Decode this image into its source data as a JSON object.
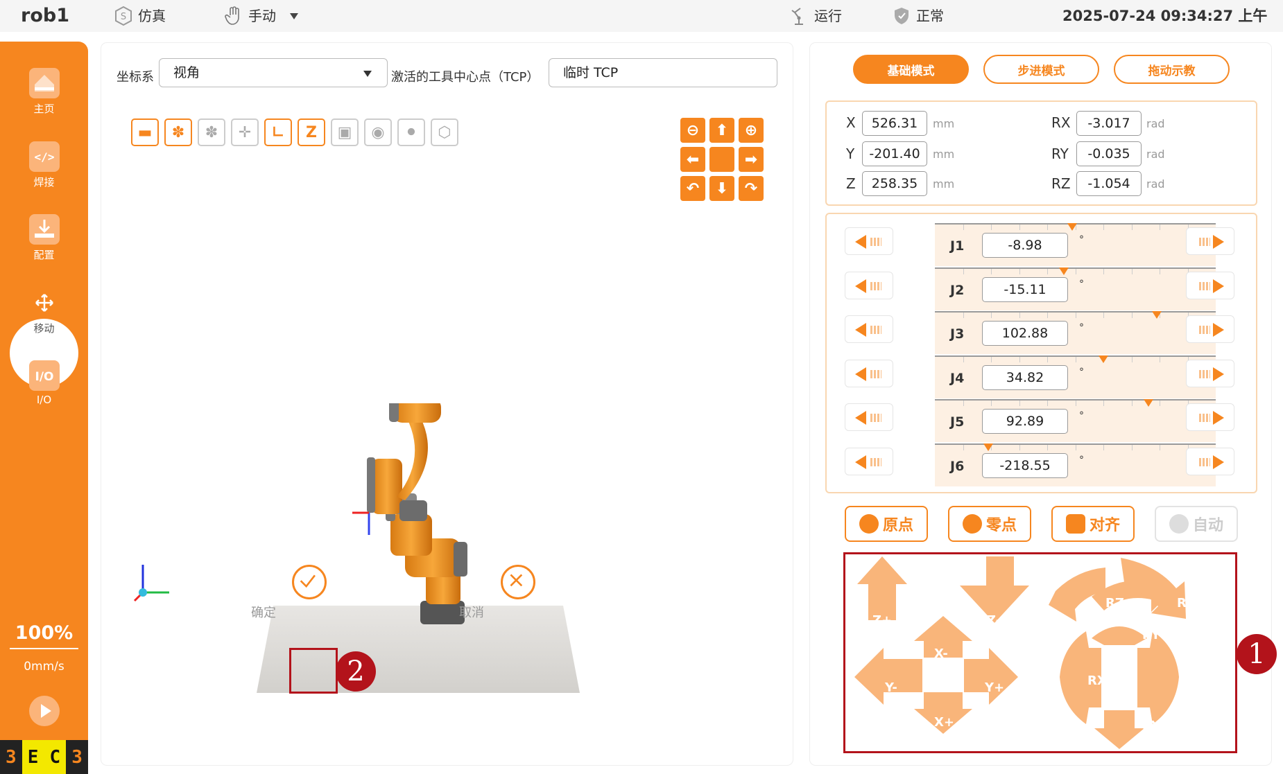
{
  "topbar": {
    "brand": "rob1",
    "sim_label": "仿真",
    "manual_label": "手动",
    "run_label": "运行",
    "status_label": "正常",
    "datetime": "2025-07-24 09:34:27 上午"
  },
  "sidebar": {
    "items": [
      {
        "label": "主页",
        "icon": "home-icon"
      },
      {
        "label": "焊接",
        "icon": "code-icon"
      },
      {
        "label": "配置",
        "icon": "download-icon"
      },
      {
        "label": "移动",
        "icon": "move-icon"
      },
      {
        "label": "I/O",
        "icon": "io-icon"
      }
    ],
    "speed_percent": "100%",
    "speed_value": "0mm/s",
    "badges": [
      "3",
      "E",
      "C",
      "3"
    ]
  },
  "view": {
    "coord_label": "坐标系",
    "coord_value": "视角",
    "tcp_label": "激活的工具中心点（TCP）",
    "tcp_value": "临时 TCP",
    "confirm_label": "确定",
    "cancel_label": "取消",
    "callout_confirm": "2"
  },
  "modes": [
    "基础模式",
    "步进模式",
    "拖动示教"
  ],
  "cartesian": {
    "x": {
      "label": "X",
      "value": "526.31",
      "unit": "mm"
    },
    "y": {
      "label": "Y",
      "value": "-201.40",
      "unit": "mm"
    },
    "z": {
      "label": "Z",
      "value": "258.35",
      "unit": "mm"
    },
    "rx": {
      "label": "RX",
      "value": "-3.017",
      "unit": "rad"
    },
    "ry": {
      "label": "RY",
      "value": "-0.035",
      "unit": "rad"
    },
    "rz": {
      "label": "RZ",
      "value": "-1.054",
      "unit": "rad"
    }
  },
  "joints": [
    {
      "label": "J1",
      "value": "-8.98",
      "unit": "°",
      "marker_fraction": 0.49
    },
    {
      "label": "J2",
      "value": "-15.11",
      "unit": "°",
      "marker_fraction": 0.46
    },
    {
      "label": "J3",
      "value": "102.88",
      "unit": "°",
      "marker_fraction": 0.79
    },
    {
      "label": "J4",
      "value": "34.82",
      "unit": "°",
      "marker_fraction": 0.6
    },
    {
      "label": "J5",
      "value": "92.89",
      "unit": "°",
      "marker_fraction": 0.76
    },
    {
      "label": "J6",
      "value": "-218.55",
      "unit": "°",
      "marker_fraction": 0.19
    }
  ],
  "functions": [
    "原点",
    "零点",
    "对齐",
    "自动"
  ],
  "jog": {
    "zplus": "Z+",
    "zminus": "Z-",
    "xminus": "X-",
    "xplus": "X+",
    "yminus": "Y-",
    "yplus": "Y+",
    "rzplus": "RZ+",
    "rzminus": "RZ-",
    "ryminus": "RY-",
    "ryplus": "RY+",
    "rxplus": "RX+",
    "rxminus": "RX-",
    "callout": "1"
  },
  "colors": {
    "accent": "#f6861f",
    "callout": "#b3131b",
    "panel_border": "#f9d6b0"
  }
}
